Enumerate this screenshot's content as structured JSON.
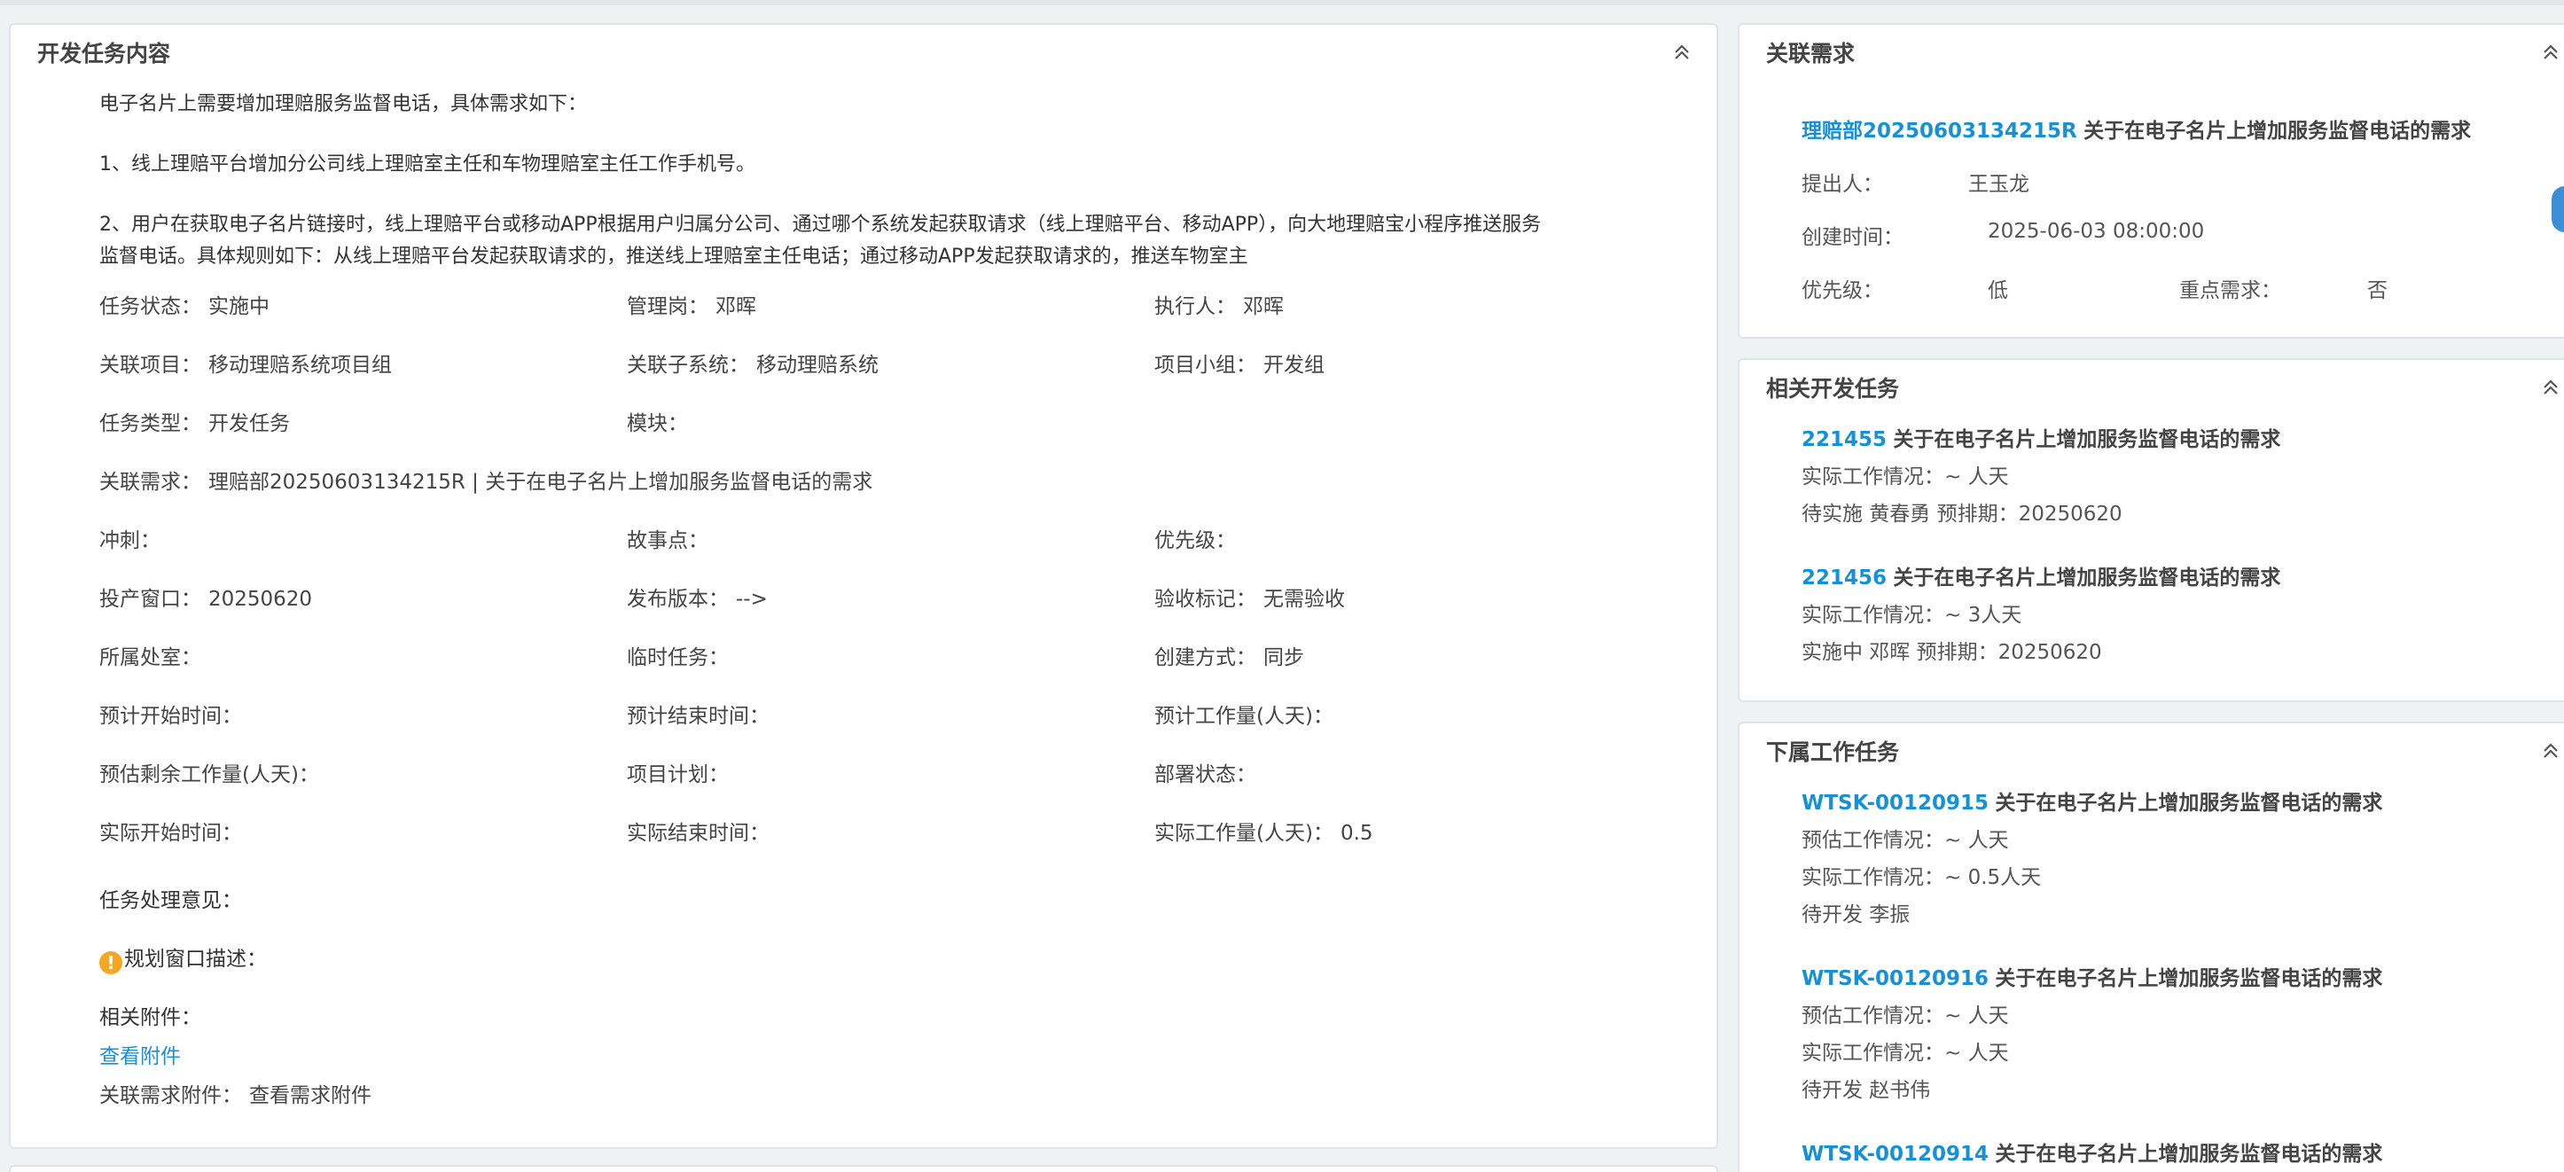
{
  "main": {
    "title": "开发任务内容",
    "desc_line1": "电子名片上需要增加理赔服务监督电话，具体需求如下：",
    "desc_line2": "1、线上理赔平台增加分公司线上理赔室主任和车物理赔室主任工作手机号。",
    "desc_line3": "2、用户在获取电子名片链接时，线上理赔平台或移动APP根据用户归属分公司、通过哪个系统发起获取请求（线上理赔平台、移动APP），向大地理赔宝小程序推送服务",
    "desc_line4": "监督电话。具体规则如下：从线上理赔平台发起获取请求的，推送线上理赔室主任电话；通过移动APP发起获取请求的，推送车物室主",
    "fields": {
      "task_status": {
        "label": "任务状态：",
        "value": "实施中"
      },
      "manager": {
        "label": "管理岗：",
        "value": "邓晖"
      },
      "executor": {
        "label": "执行人：",
        "value": "邓晖"
      },
      "project": {
        "label": "关联项目：",
        "value": "移动理赔系统项目组"
      },
      "subsystem": {
        "label": "关联子系统：",
        "value": "移动理赔系统"
      },
      "team": {
        "label": "项目小组：",
        "value": "开发组"
      },
      "task_type": {
        "label": "任务类型：",
        "value": "开发任务"
      },
      "module": {
        "label": "模块：",
        "value": ""
      },
      "related_req": {
        "label": "关联需求：",
        "value": "理赔部20250603134215R | 关于在电子名片上增加服务监督电话的需求"
      },
      "sprint": {
        "label": "冲刺：",
        "value": ""
      },
      "story_points": {
        "label": "故事点：",
        "value": ""
      },
      "priority": {
        "label": "优先级：",
        "value": ""
      },
      "release_window": {
        "label": "投产窗口：",
        "value": "20250620"
      },
      "release_version": {
        "label": "发布版本：",
        "value": "-->"
      },
      "acceptance": {
        "label": "验收标记：",
        "value": "无需验收"
      },
      "department": {
        "label": "所属处室：",
        "value": ""
      },
      "temp_task": {
        "label": "临时任务：",
        "value": ""
      },
      "create_mode": {
        "label": "创建方式：",
        "value": "同步"
      },
      "plan_start": {
        "label": "预计开始时间：",
        "value": ""
      },
      "plan_end": {
        "label": "预计结束时间：",
        "value": ""
      },
      "plan_effort": {
        "label": "预计工作量(人天)：",
        "value": ""
      },
      "remaining_effort": {
        "label": "预估剩余工作量(人天)：",
        "value": ""
      },
      "project_plan": {
        "label": "项目计划：",
        "value": ""
      },
      "deploy_status": {
        "label": "部署状态：",
        "value": ""
      },
      "actual_start": {
        "label": "实际开始时间：",
        "value": ""
      },
      "actual_end": {
        "label": "实际结束时间：",
        "value": ""
      },
      "actual_effort": {
        "label": "实际工作量(人天)：",
        "value": "0.5"
      }
    },
    "opinion_label": "任务处理意见：",
    "plan_window_label": "规划窗口描述：",
    "attachments_label": "相关附件：",
    "view_attachments": "查看附件",
    "req_attachments_label": "关联需求附件：",
    "view_req_attachments": "查看需求附件"
  },
  "requirement": {
    "title": "关联需求",
    "code": "理赔部20250603134215R",
    "name": "关于在电子名片上增加服务监督电话的需求",
    "proposer_label": "提出人：",
    "proposer": "王玉龙",
    "created_label": "创建时间：",
    "created": "2025-06-03 08:00:00",
    "priority_label": "优先级：",
    "priority": "低",
    "key_label": "重点需求：",
    "key": "否"
  },
  "related_tasks": {
    "title": "相关开发任务",
    "items": [
      {
        "id": "221455",
        "name": "关于在电子名片上增加服务监督电话的需求",
        "actual": "实际工作情况：~ 人天",
        "status": "待实施 黄春勇 预排期：20250620"
      },
      {
        "id": "221456",
        "name": "关于在电子名片上增加服务监督电话的需求",
        "actual": "实际工作情况：~ 3人天",
        "status": "实施中 邓晖 预排期：20250620"
      }
    ]
  },
  "sub_tasks": {
    "title": "下属工作任务",
    "items": [
      {
        "id": "WTSK-00120915",
        "name": "关于在电子名片上增加服务监督电话的需求",
        "estimate": "预估工作情况：~ 人天",
        "actual": "实际工作情况：~ 0.5人天",
        "status": "待开发 李振"
      },
      {
        "id": "WTSK-00120916",
        "name": "关于在电子名片上增加服务监督电话的需求",
        "estimate": "预估工作情况：~ 人天",
        "actual": "实际工作情况：~ 人天",
        "status": "待开发 赵书伟"
      },
      {
        "id": "WTSK-00120914",
        "name": "关于在电子名片上增加服务监督电话的需求"
      }
    ]
  },
  "icons": {
    "collapse": "chevron-double-up-icon",
    "warning": "exclamation-circle-icon"
  },
  "colors": {
    "link": "#1890d5",
    "warning": "#f5a623"
  }
}
